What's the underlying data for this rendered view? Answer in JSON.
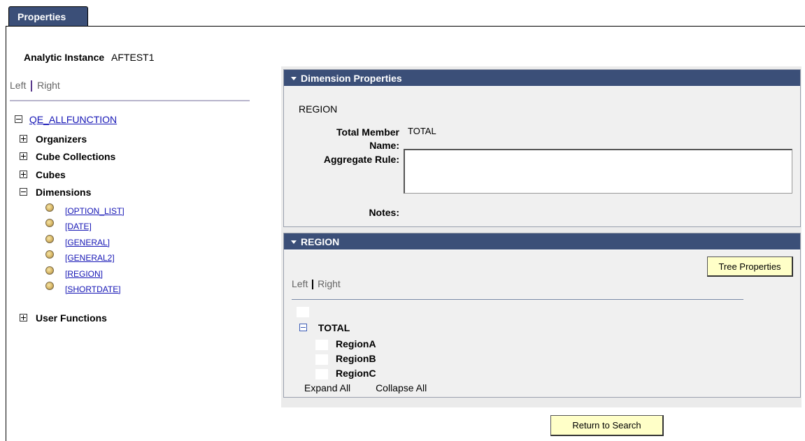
{
  "tab": {
    "label": "Properties"
  },
  "instance": {
    "label": "Analytic Instance",
    "value": "AFTEST1"
  },
  "left_nav": {
    "left": "Left",
    "right": "Right"
  },
  "tree": {
    "root": "QE_ALLFUNCTION",
    "nodes": [
      "Organizers",
      "Cube Collections",
      "Cubes",
      "Dimensions"
    ],
    "dimensions": [
      "[OPTION_LIST]",
      "[DATE]",
      "[GENERAL]",
      "[GENERAL2]",
      "[REGION]",
      "[SHORTDATE]"
    ],
    "last": "User Functions"
  },
  "dim_props": {
    "title": "Dimension Properties",
    "name": "REGION",
    "total_member_label_1": "Total Member",
    "total_member_label_2": "Name:",
    "total_member_value": "TOTAL",
    "aggregate_label": "Aggregate Rule:",
    "aggregate_value": "",
    "notes_label": "Notes:"
  },
  "region": {
    "title": "REGION",
    "tree_props_button": "Tree Properties",
    "nav_left": "Left",
    "nav_right": "Right",
    "root": "TOTAL",
    "children": [
      "RegionA",
      "RegionB",
      "RegionC"
    ],
    "expand_all": "Expand All",
    "collapse_all": "Collapse All"
  },
  "return_button": "Return to Search",
  "colors": {
    "header": "#3b4f78",
    "button": "#ffffc8",
    "link": "#1515b5",
    "panel_bg": "#f0f0f0"
  }
}
